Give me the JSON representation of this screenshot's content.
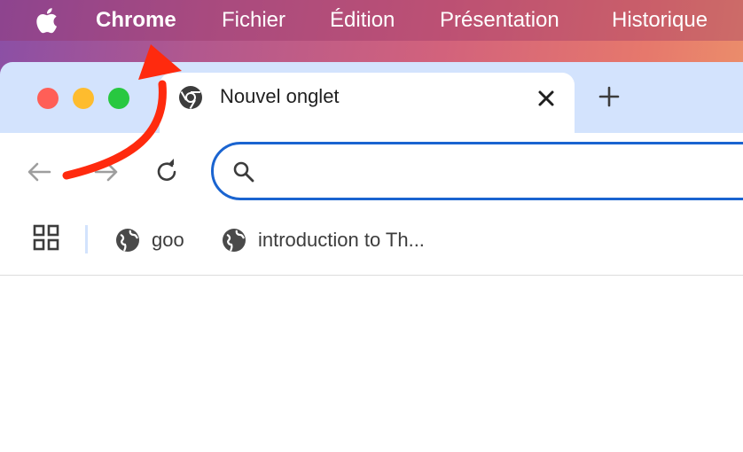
{
  "menubar": {
    "apple_icon": "apple-logo-icon",
    "app_name": "Chrome",
    "items": [
      "Fichier",
      "Édition",
      "Présentation",
      "Historique"
    ]
  },
  "window_controls": {
    "close_color": "#ff5f57",
    "minimize_color": "#febc2e",
    "zoom_color": "#28c840"
  },
  "tabs": [
    {
      "title": "Nouvel onglet",
      "icon": "chrome-logo-icon",
      "active": true
    }
  ],
  "new_tab_icon": "plus-icon",
  "toolbar": {
    "back_icon": "arrow-left-icon",
    "forward_icon": "arrow-right-icon",
    "reload_icon": "reload-icon"
  },
  "omnibox": {
    "value": "",
    "icon": "search-icon"
  },
  "bookmarks_bar": {
    "apps_icon": "apps-grid-icon",
    "items": [
      {
        "label": "goo",
        "icon": "globe-icon"
      },
      {
        "label": "introduction to Th...",
        "icon": "globe-icon"
      }
    ]
  },
  "annotation": {
    "type": "curved-arrow",
    "color": "#ff2a0e",
    "points_to": "Chrome"
  },
  "colors": {
    "tabstrip_bg": "#d3e3fd",
    "omnibox_border": "#1a64d0",
    "menu_text": "#ffffff"
  }
}
